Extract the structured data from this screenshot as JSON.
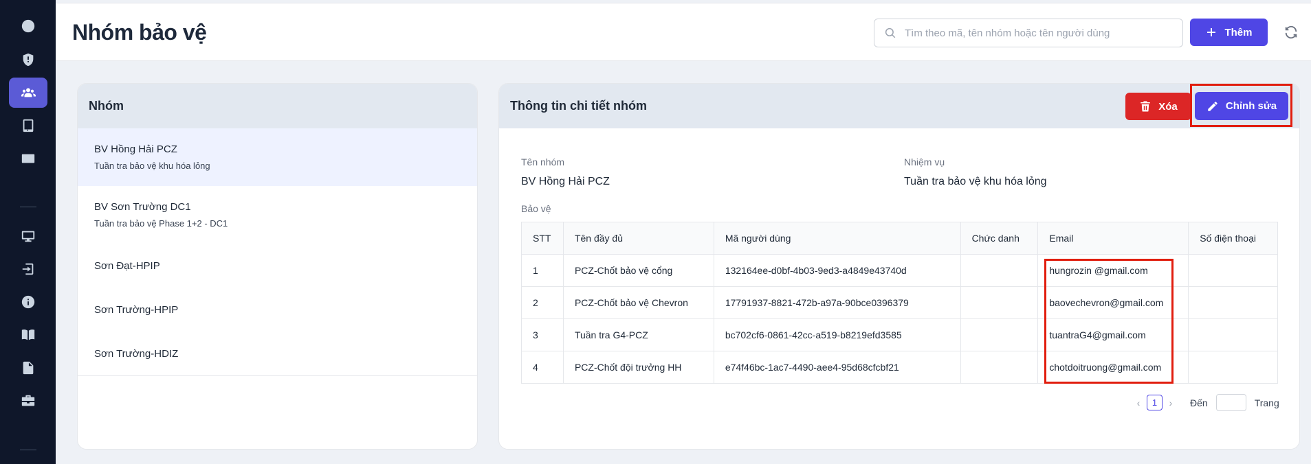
{
  "header": {
    "title": "Nhóm bảo vệ",
    "search_placeholder": "Tìm theo mã, tên nhóm hoặc tên người dùng",
    "add_label": "Thêm"
  },
  "sidebar": {
    "items": [
      {
        "icon": "clock-icon",
        "active": false
      },
      {
        "icon": "shield-icon",
        "active": false
      },
      {
        "icon": "users-icon",
        "active": true
      },
      {
        "icon": "tablet-icon",
        "active": false
      },
      {
        "icon": "card-icon",
        "active": false
      },
      {
        "icon": "monitor-icon",
        "active": false
      },
      {
        "icon": "login-icon",
        "active": false
      },
      {
        "icon": "info-icon",
        "active": false
      },
      {
        "icon": "book-icon",
        "active": false
      },
      {
        "icon": "document-icon",
        "active": false
      },
      {
        "icon": "briefcase-icon",
        "active": false
      }
    ]
  },
  "groups": {
    "heading": "Nhóm",
    "items": [
      {
        "name": "BV Hồng Hải PCZ",
        "desc": "Tuần tra bảo vệ khu hóa lỏng",
        "active": true
      },
      {
        "name": "BV Sơn Trường DC1",
        "desc": "Tuần tra bảo vệ Phase 1+2 - DC1",
        "active": false
      },
      {
        "name": "Sơn Đạt-HPIP",
        "desc": "",
        "active": false
      },
      {
        "name": "Sơn Trường-HPIP",
        "desc": "",
        "active": false
      },
      {
        "name": "Sơn Trường-HDIZ",
        "desc": "",
        "active": false
      }
    ]
  },
  "detail": {
    "heading": "Thông tin chi tiết nhóm",
    "delete_label": "Xóa",
    "edit_label": "Chỉnh sửa",
    "group_name_label": "Tên nhóm",
    "group_name": "BV Hồng Hải PCZ",
    "duty_label": "Nhiệm vụ",
    "duty": "Tuần tra bảo vệ khu hóa lỏng",
    "guards_label": "Bảo vệ",
    "table": {
      "columns": [
        "STT",
        "Tên đầy đủ",
        "Mã người dùng",
        "Chức danh",
        "Email",
        "Số điện thoại"
      ],
      "rows": [
        [
          "1",
          "PCZ-Chốt bảo vệ cổng",
          "132164ee-d0bf-4b03-9ed3-a4849e43740d",
          "",
          "hungrozin @gmail.com",
          ""
        ],
        [
          "2",
          "PCZ-Chốt bảo vệ Chevron",
          "17791937-8821-472b-a97a-90bce0396379",
          "",
          "baovechevron@gmail.com",
          ""
        ],
        [
          "3",
          "Tuần tra G4-PCZ",
          "bc702cf6-0861-42cc-a519-b8219efd3585",
          "",
          "tuantraG4@gmail.com",
          ""
        ],
        [
          "4",
          "PCZ-Chốt đội trưởng HH",
          "e74f46bc-1ac7-4490-aee4-95d68cfcbf21",
          "",
          "chotdoitruong@gmail.com",
          ""
        ]
      ]
    },
    "pagination": {
      "prev": "‹",
      "current": "1",
      "next": "›",
      "goto_label": "Đến",
      "page_label": "Trang"
    }
  },
  "colors": {
    "accent": "#4f46e5",
    "danger": "#dc2626",
    "sidebar_bg": "#0f172a",
    "highlight_box": "#e11d0e"
  }
}
